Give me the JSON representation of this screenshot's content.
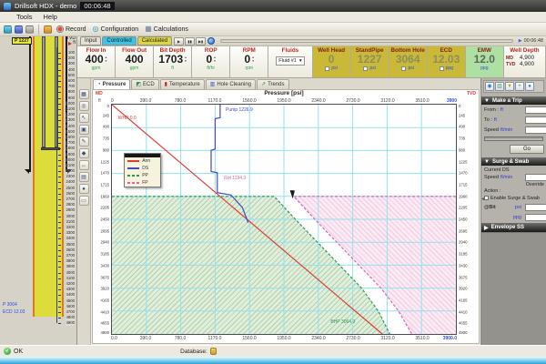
{
  "window": {
    "title": "Drillsoft HDX - demo",
    "timer": "00:06:48"
  },
  "menu": {
    "items": [
      "Tools",
      "Help"
    ]
  },
  "toolbar": {
    "icons": [
      "open-icon",
      "save-icon",
      "print-icon",
      "gauge-icon"
    ],
    "record_label": "Record",
    "configuration_label": "Configuration",
    "calculations_label": "Calculations"
  },
  "transport": {
    "tabs": [
      {
        "label": "Input",
        "color": "#e4e0d4"
      },
      {
        "label": "Controlled",
        "color": "#38c6e8"
      },
      {
        "label": "Calculated",
        "color": "#ddd540"
      }
    ],
    "buttons": [
      "play",
      "pause",
      "step"
    ],
    "time": "00:06:48"
  },
  "gauges": {
    "columns": [
      {
        "label": "Flow In",
        "value": "400",
        "unit": "gpm",
        "style": "white",
        "spinner": true
      },
      {
        "label": "Flow Out",
        "value": "400",
        "unit": "gpm",
        "style": "white"
      },
      {
        "label": "Bit Depth",
        "value": "1703",
        "unit": "ft",
        "style": "white",
        "spinner": true
      },
      {
        "label": "ROP",
        "value": "0",
        "unit": "ft/hr",
        "style": "white",
        "spinner": true
      },
      {
        "label": "RPM",
        "value": "0",
        "unit": "rpm",
        "style": "white",
        "spinner": true
      },
      {
        "label": "Fluids",
        "value": "Fluid #1",
        "style": "dropdown"
      },
      {
        "label": "Well Head",
        "value": "0",
        "unit": "psi",
        "style": "olive",
        "checkbox": true
      },
      {
        "label": "StandPipe",
        "value": "1227",
        "unit": "psi",
        "style": "olive",
        "checkbox": true
      },
      {
        "label": "Bottom Hole",
        "value": "3064",
        "unit": "psi",
        "style": "olive",
        "checkbox": true
      },
      {
        "label": "ECD",
        "value": "12.03",
        "unit": "ppg",
        "style": "olive",
        "checkbox": true
      },
      {
        "label": "EMW",
        "value": "12.0",
        "unit": "ppg",
        "style": "green"
      },
      {
        "label": "Well Depth",
        "style": "depth",
        "rows": [
          {
            "k": "MD",
            "v": "4,900"
          },
          {
            "k": "TVD",
            "v": "4,900"
          }
        ]
      }
    ]
  },
  "well_panel": {
    "ruler_title": "TVD",
    "ruler_unit": "ft",
    "top_label": "P 1227",
    "bottom_pressure": "P 3064",
    "bottom_ecd": "ECD 12.03",
    "depth_min": 0,
    "depth_max": 4900,
    "tick_step": 100,
    "strata": [
      {
        "c": "#c9dcc6",
        "p": "p-hatchg",
        "h": 46
      },
      {
        "c": "#d9cf9e",
        "p": "p-dots",
        "h": 4
      },
      {
        "c": "#c4d6da",
        "p": "p-hatchb",
        "h": 4.5
      },
      {
        "c": "#eee6c4",
        "p": "p-dots",
        "h": 5
      },
      {
        "c": "#b4cfe6",
        "p": "p-hatchb",
        "h": 3.5
      },
      {
        "c": "#eee6c4",
        "p": "p-dots",
        "h": 6
      },
      {
        "c": "#f0ae6a",
        "p": "p-dots",
        "h": 4.5
      },
      {
        "c": "#e6dfc0",
        "p": "p-dots",
        "h": 3
      },
      {
        "c": "#b4cfe6",
        "p": "p-hatchb",
        "h": 4.5
      },
      {
        "c": "#eee6c4",
        "p": "p-dots",
        "h": 4
      },
      {
        "c": "#c4d6da",
        "p": "p-hatchb",
        "h": 4
      },
      {
        "c": "#e6dfc0",
        "p": "p-dots",
        "h": 4
      },
      {
        "c": "#b4cfe6",
        "p": "p-hatchb",
        "h": 3
      },
      {
        "c": "#eee6c4",
        "p": "p-dots",
        "h": 4
      }
    ]
  },
  "toolstrip": {
    "icons": [
      "grid-icon",
      "target-icon",
      "pointer-icon",
      "image-icon",
      "edit-icon",
      "palette-icon",
      "move-icon",
      "table-icon",
      "globe-icon",
      "print-icon"
    ]
  },
  "chart_tabs": [
    {
      "label": "Pressure",
      "icon": "gauge-icon",
      "active": true
    },
    {
      "label": "ECD",
      "icon": "ecd-icon"
    },
    {
      "label": "Temperature",
      "icon": "thermometer-icon"
    },
    {
      "label": "Hole Cleaning",
      "icon": "holeclean-icon"
    },
    {
      "label": "Trends",
      "icon": "trends-icon"
    }
  ],
  "chart_data": {
    "type": "line",
    "title": "Pressure [psi]",
    "x_axis": {
      "label": "Pressure [psi]",
      "min": 0,
      "max": 3900,
      "tick_step": 390
    },
    "y_left": {
      "label": "MD",
      "unit": "ft",
      "min": 0,
      "max": 4900,
      "tick_step": 245
    },
    "y_right": {
      "label": "TVD",
      "min": 0,
      "max": 4900,
      "tick_step": 245
    },
    "grid": {
      "color": "#8fe3ef",
      "x_step": 390,
      "y_step": 490
    },
    "series": [
      {
        "name": "Ann",
        "color": "#e03c34",
        "style": "solid",
        "points": [
          [
            0,
            0
          ],
          [
            3064.3,
            4900
          ]
        ]
      },
      {
        "name": "DS",
        "color": "#4448c8",
        "style": "solid",
        "points": [
          [
            1226.9,
            0
          ],
          [
            1226.9,
            280
          ],
          [
            1170,
            300
          ],
          [
            1170,
            950
          ],
          [
            1125,
            975
          ],
          [
            1125,
            1430
          ],
          [
            1194.3,
            1455
          ],
          [
            1194.3,
            1880
          ],
          [
            1350,
            1930
          ],
          [
            1480,
            2200
          ],
          [
            1545,
            2520
          ]
        ]
      },
      {
        "name": "PP",
        "color": "#2e9a4e",
        "style": "dashed",
        "points": [
          [
            0,
            1960
          ],
          [
            1840,
            1960
          ],
          [
            2080,
            2450
          ],
          [
            2330,
            2940
          ],
          [
            2580,
            3430
          ],
          [
            2830,
            3920
          ],
          [
            3020,
            4410
          ],
          [
            3150,
            4900
          ]
        ]
      },
      {
        "name": "FP",
        "color": "#e060c0",
        "style": "dashed",
        "points": [
          [
            3900,
            1960
          ],
          [
            2060,
            1960
          ],
          [
            2300,
            2450
          ],
          [
            2550,
            2940
          ],
          [
            2800,
            3430
          ],
          [
            3050,
            3920
          ],
          [
            3250,
            4410
          ],
          [
            3400,
            4900
          ]
        ]
      }
    ],
    "regions": [
      {
        "name": "pore-pressure-region",
        "class": "region-pp",
        "points": [
          [
            0,
            1960
          ],
          [
            1840,
            1960
          ],
          [
            2080,
            2450
          ],
          [
            2330,
            2940
          ],
          [
            2580,
            3430
          ],
          [
            2830,
            3920
          ],
          [
            3020,
            4410
          ],
          [
            3150,
            4900
          ],
          [
            0,
            4900
          ]
        ]
      },
      {
        "name": "frac-pressure-region",
        "class": "region-fp",
        "points": [
          [
            2060,
            1960
          ],
          [
            3900,
            1960
          ],
          [
            3900,
            4900
          ],
          [
            3400,
            4900
          ],
          [
            3250,
            4410
          ],
          [
            3050,
            3920
          ],
          [
            2800,
            3430
          ],
          [
            2550,
            2940
          ],
          [
            2300,
            2450
          ]
        ]
      }
    ],
    "annotations": [
      {
        "text": "WHP 0.0",
        "x": 70,
        "y": 300,
        "color": "#e03c34"
      },
      {
        "text": "Pump 1226.9",
        "x": 1290,
        "y": 120,
        "color": "#4448c8"
      },
      {
        "text": "Rot 1194.3",
        "x": 1270,
        "y": 1570,
        "color": "#e0607c"
      },
      {
        "text": "BHP 3064.3",
        "x": 2480,
        "y": 4640,
        "color": "#2e9a4e"
      }
    ],
    "legend": {
      "position": "left-middle",
      "entries": [
        {
          "label": "Ann",
          "color": "#e03c34",
          "style": "solid"
        },
        {
          "label": "DS",
          "color": "#4448c8",
          "style": "solid"
        },
        {
          "label": "PP",
          "color": "#2e9a4e",
          "style": "dashed"
        },
        {
          "label": "FP",
          "color": "#e060c0",
          "style": "dashed"
        }
      ]
    }
  },
  "right_panel": {
    "icons": [
      "globe-icon",
      "bars-icon",
      "flask-icon",
      "wrench-icon",
      "droplet-icon"
    ],
    "trip": {
      "title": "Make a Trip",
      "from_label": "From :",
      "to_label": "To :",
      "speed_label": "Speed",
      "unit_ft": "ft",
      "unit_speed": "ft/min",
      "go": "Go"
    },
    "surge": {
      "title": "Surge & Swab",
      "current_ds": "Current DS",
      "speed_label": "Speed",
      "unit_speed": "ft/min",
      "override": "Override",
      "action": "Action :",
      "enable": "Enable Surge & Swab",
      "at_bit": "@Bit",
      "psi": "psi",
      "ppg": "ppg"
    },
    "envelope": {
      "title": "Envelope SS"
    }
  },
  "statusbar": {
    "ok": "OK",
    "database": "Database:"
  }
}
